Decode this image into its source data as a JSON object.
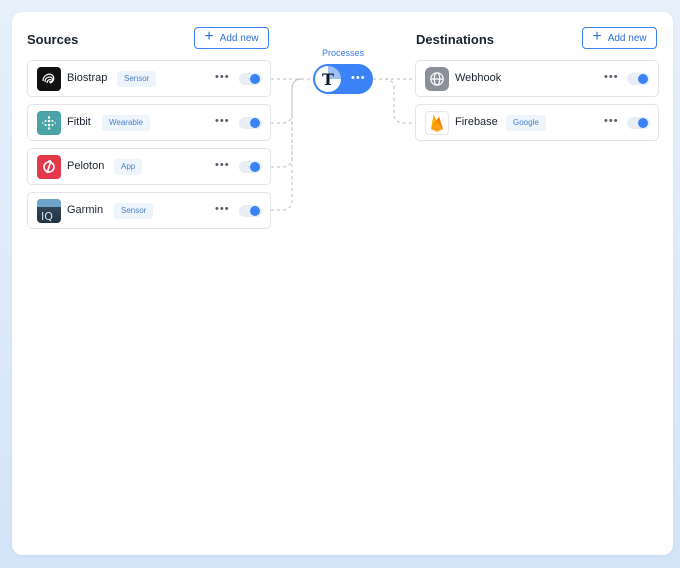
{
  "sources": {
    "title": "Sources",
    "add_label": "Add new",
    "items": [
      {
        "name": "Biostrap",
        "tag": "Sensor",
        "menu": "•••"
      },
      {
        "name": "Fitbit",
        "tag": "Wearable",
        "menu": "•••"
      },
      {
        "name": "Peloton",
        "tag": "App",
        "menu": "•••"
      },
      {
        "name": "Garmin",
        "tag": "Sensor",
        "menu": "•••"
      }
    ]
  },
  "processes": {
    "label": "Processes",
    "glyph": "T",
    "menu": "•••"
  },
  "destinations": {
    "title": "Destinations",
    "add_label": "Add new",
    "items": [
      {
        "name": "Webhook",
        "menu": "•••"
      },
      {
        "name": "Firebase",
        "tag": "Google",
        "menu": "•••"
      }
    ]
  },
  "colors": {
    "accent": "#3b82f6",
    "tag_bg": "#eef4fc",
    "tag_text": "#4a7fc9"
  },
  "icons": {
    "biostrap": "biostrap-logo-icon",
    "fitbit": "fitbit-logo-icon",
    "peloton": "peloton-logo-icon",
    "garmin": "garmin-iq-logo-icon",
    "webhook": "globe-icon",
    "firebase": "firebase-flame-icon"
  }
}
